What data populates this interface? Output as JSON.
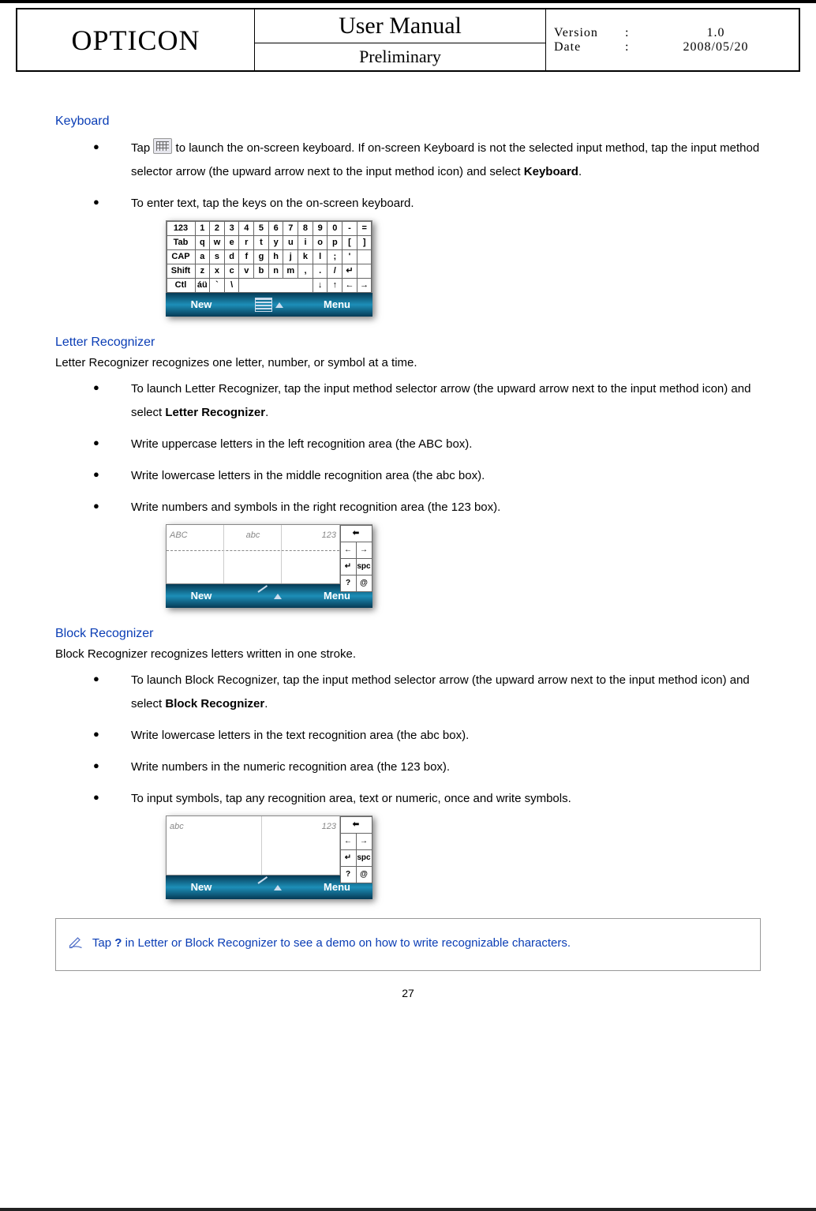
{
  "header": {
    "brand": "OPTICON",
    "title": "User Manual",
    "subtitle": "Preliminary",
    "version_label": "Version",
    "version_value": "1.0",
    "date_label": "Date",
    "date_value": "2008/05/20"
  },
  "sections": {
    "keyboard": {
      "heading": "Keyboard",
      "b1_a": "Tap ",
      "b1_b": " to launch the on-screen keyboard. If on-screen Keyboard is not the selected input method, tap the input method selector arrow (the upward arrow next to the input method icon) and select ",
      "b1_bold": "Keyboard",
      "b1_c": ".",
      "b2": "To enter text, tap the keys on the on-screen keyboard."
    },
    "letter": {
      "heading": "Letter Recognizer",
      "intro": "Letter Recognizer recognizes one letter, number, or symbol at a time.",
      "b1_a": "To launch Letter Recognizer, tap the input method selector arrow (the upward arrow next to the input method icon) and select ",
      "b1_bold": "Letter Recognizer",
      "b1_b": ".",
      "b2": "Write uppercase letters in the left recognition area (the ABC box).",
      "b3": "Write lowercase letters in the middle recognition area (the abc box).",
      "b4": "Write numbers and symbols in the right recognition area (the 123 box).",
      "areas": {
        "a": "ABC",
        "b": "abc",
        "c": "123"
      }
    },
    "block": {
      "heading": "Block Recognizer",
      "intro": "Block Recognizer recognizes letters written in one stroke.",
      "b1_a": "To launch Block Recognizer, tap the input method selector arrow (the upward arrow next to the input method icon) and select ",
      "b1_bold": "Block Recognizer",
      "b1_b": ".",
      "b2": "Write lowercase letters in the text recognition area (the abc box).",
      "b3": "Write numbers in the numeric recognition area (the 123 box).",
      "b4": "To input symbols, tap any recognition area, text or numeric, once and write symbols.",
      "areas": {
        "a": "abc",
        "b": "123"
      }
    }
  },
  "keyboard_rows": {
    "r1": [
      "123",
      "1",
      "2",
      "3",
      "4",
      "5",
      "6",
      "7",
      "8",
      "9",
      "0",
      "-",
      "=",
      "⬅"
    ],
    "r2": [
      "Tab",
      "q",
      "w",
      "e",
      "r",
      "t",
      "y",
      "u",
      "i",
      "o",
      "p",
      "[",
      "]"
    ],
    "r3": [
      "CAP",
      "a",
      "s",
      "d",
      "f",
      "g",
      "h",
      "j",
      "k",
      "l",
      ";",
      "'",
      ""
    ],
    "r4": [
      "Shift",
      "z",
      "x",
      "c",
      "v",
      "b",
      "n",
      "m",
      ",",
      ".",
      "/",
      "↵",
      ""
    ],
    "r5": [
      "Ctl",
      "áü",
      "`",
      "\\",
      "",
      "",
      "",
      "",
      "",
      "↓",
      "↑",
      "←",
      "→"
    ]
  },
  "side_keys": {
    "bksp": "⬅",
    "left": "←",
    "right": "→",
    "enter": "↵",
    "spc": "spc",
    "help": "?",
    "at": "@"
  },
  "menubar": {
    "left": "New",
    "right": "Menu"
  },
  "tip": {
    "a": "Tap ",
    "q": "?",
    "b": " in Letter or Block Recognizer to see a demo on how to write recognizable characters."
  },
  "page_number": "27"
}
